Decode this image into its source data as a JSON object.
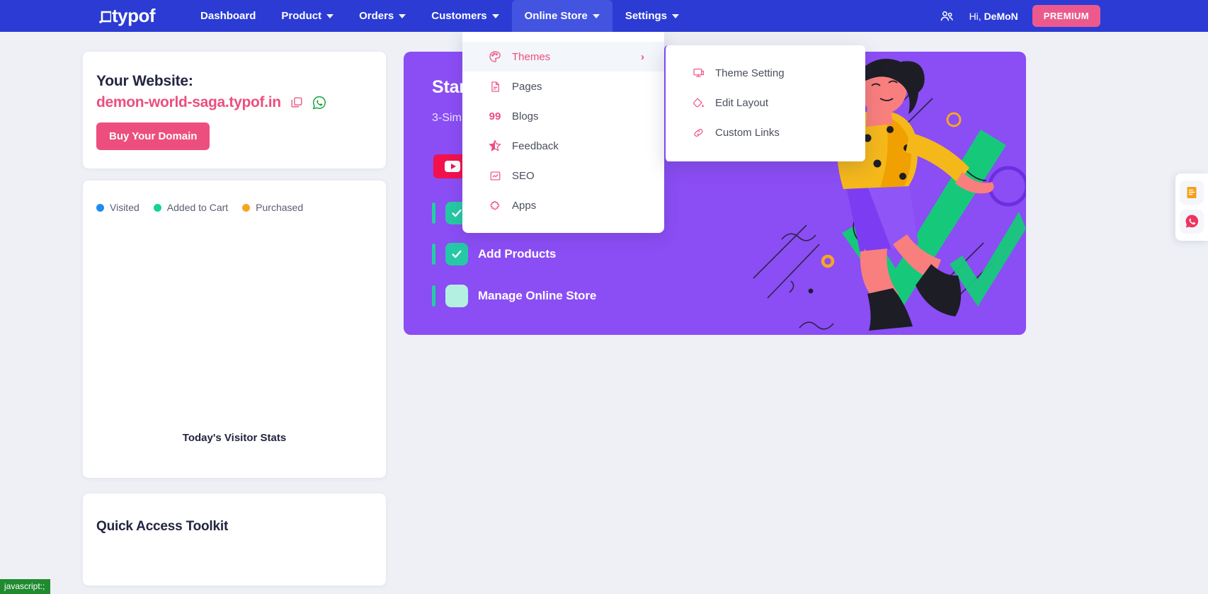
{
  "navbar": {
    "logo": ".typof",
    "items": [
      {
        "label": "Dashboard",
        "has_caret": false,
        "active": false,
        "name": "nav-dashboard"
      },
      {
        "label": "Product",
        "has_caret": true,
        "active": false,
        "name": "nav-product"
      },
      {
        "label": "Orders",
        "has_caret": true,
        "active": false,
        "name": "nav-orders"
      },
      {
        "label": "Customers",
        "has_caret": true,
        "active": false,
        "name": "nav-customers"
      },
      {
        "label": "Online Store",
        "has_caret": true,
        "active": true,
        "name": "nav-online-store"
      },
      {
        "label": "Settings",
        "has_caret": true,
        "active": false,
        "name": "nav-settings"
      }
    ],
    "people_icon": "people-icon",
    "greeting_prefix": "Hi, ",
    "user_name": "DeMoN",
    "premium_label": "PREMIUM",
    "bg_color": "#2b3bd4",
    "active_bg_color": "#4254e0",
    "premium_color": "#ec5a8d"
  },
  "dropdown": {
    "items": [
      {
        "label": "Themes",
        "icon": "palette-icon",
        "active": true,
        "has_submenu": true,
        "chevron": "›"
      },
      {
        "label": "Pages",
        "icon": "document-icon",
        "active": false,
        "has_submenu": false
      },
      {
        "label": "Blogs",
        "icon": "quote-icon",
        "active": false,
        "has_submenu": false,
        "glyph": "99"
      },
      {
        "label": "Feedback",
        "icon": "star-icon",
        "active": false,
        "has_submenu": false
      },
      {
        "label": "SEO",
        "icon": "seo-chart-icon",
        "active": false,
        "has_submenu": false
      },
      {
        "label": "Apps",
        "icon": "puzzle-icon",
        "active": false,
        "has_submenu": false
      }
    ],
    "accent_color": "#ed4f7e"
  },
  "submenu": {
    "items": [
      {
        "label": "Theme Setting",
        "icon": "monitor-icon"
      },
      {
        "label": "Edit Layout",
        "icon": "paint-bucket-icon"
      },
      {
        "label": "Custom Links",
        "icon": "link-icon"
      }
    ]
  },
  "website_card": {
    "title": "Your Website:",
    "url": "demon-world-saga.typof.in",
    "copy_icon": "copy-icon",
    "whatsapp_icon": "whatsapp-icon",
    "buy_label": "Buy Your Domain",
    "url_color": "#ec4f7e"
  },
  "stats_card": {
    "legend": [
      {
        "label": "Visited",
        "color": "#1f8cf5"
      },
      {
        "label": "Added to Cart",
        "color": "#13d39a"
      },
      {
        "label": "Purchased",
        "color": "#f5a623"
      }
    ],
    "caption": "Today's Visitor Stats"
  },
  "toolkit_card": {
    "title": "Quick Access Toolkit"
  },
  "hero_card": {
    "title": "Start",
    "subtitle": "3-Sim",
    "video_button_label": "",
    "video_icon": "youtube-icon",
    "bg_color": "#8b4df4",
    "steps": [
      {
        "label": "",
        "state": "done",
        "name": "hero-step-1"
      },
      {
        "label": "Add Products",
        "state": "done",
        "name": "hero-step-add-products"
      },
      {
        "label": "Manage Online Store",
        "state": "todo",
        "name": "hero-step-manage-online-store"
      }
    ],
    "illustration": "woman-jumping-illustration"
  },
  "float_panel": {
    "buttons": [
      {
        "icon": "notes-icon",
        "color": "#f6a018"
      },
      {
        "icon": "whatsapp-icon",
        "color": "#f0335e"
      }
    ]
  },
  "status_bar": {
    "text": "javascript:;"
  }
}
